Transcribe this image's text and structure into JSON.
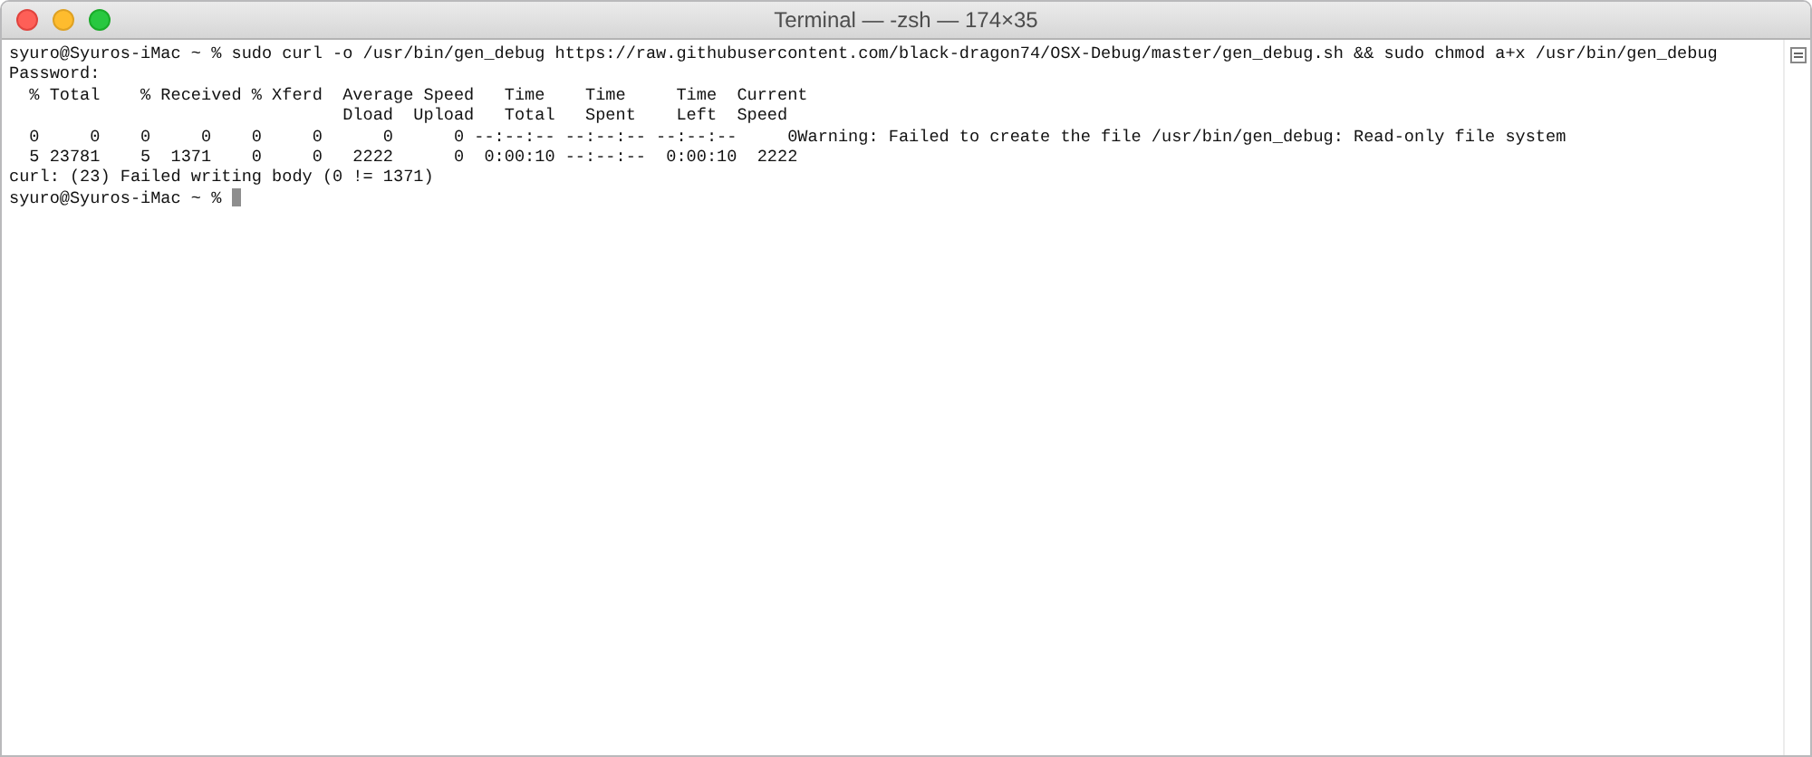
{
  "window": {
    "title": "Terminal — -zsh — 174×35"
  },
  "terminal": {
    "lines": [
      "syuro@Syuros-iMac ~ % sudo curl -o /usr/bin/gen_debug https://raw.githubusercontent.com/black-dragon74/OSX-Debug/master/gen_debug.sh && sudo chmod a+x /usr/bin/gen_debug",
      "Password:",
      "  % Total    % Received % Xferd  Average Speed   Time    Time     Time  Current",
      "                                 Dload  Upload   Total   Spent    Left  Speed",
      "  0     0    0     0    0     0      0      0 --:--:-- --:--:-- --:--:--     0Warning: Failed to create the file /usr/bin/gen_debug: Read-only file system",
      "  5 23781    5  1371    0     0   2222      0  0:00:10 --:--:--  0:00:10  2222",
      "curl: (23) Failed writing body (0 != 1371)",
      "syuro@Syuros-iMac ~ % "
    ]
  }
}
